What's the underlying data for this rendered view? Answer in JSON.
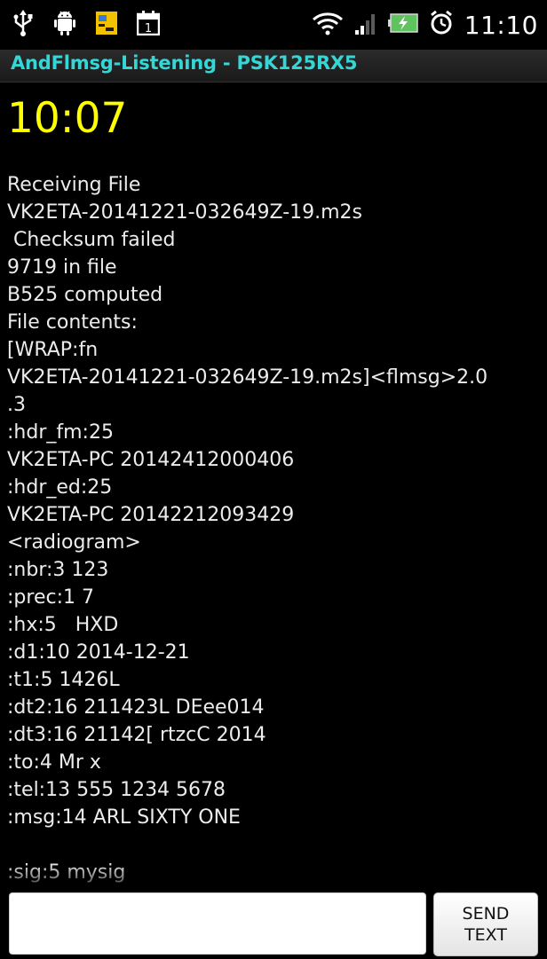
{
  "status_bar": {
    "time": "11:10",
    "left_icons": [
      "usb-icon",
      "android-debug-icon",
      "notification-app-icon",
      "calendar-icon"
    ],
    "right_icons": [
      "wifi-icon",
      "signal-icon",
      "battery-charging-icon",
      "alarm-icon"
    ],
    "calendar_day": "1"
  },
  "title_bar": {
    "title": "AndFlmsg-Listening - PSK125RX5",
    "color": "#35d6d6"
  },
  "clock": {
    "value": "10:07",
    "color": "#ffff00"
  },
  "log": {
    "lines": [
      "Receiving File",
      "VK2ETA-20141221-032649Z-19.m2s",
      " Checksum failed",
      "9719 in file",
      "B525 computed",
      "File contents:",
      "[WRAP:fn",
      "VK2ETA-20141221-032649Z-19.m2s]<flmsg>2.0",
      ".3",
      ":hdr_fm:25",
      "VK2ETA-PC 20142412000406",
      ":hdr_ed:25",
      "VK2ETA-PC 20142212093429",
      "<radiogram>",
      ":nbr:3 123",
      ":prec:1 7",
      ":hx:5   HXD",
      ":d1:10 2014-12-21",
      ":t1:5 1426L",
      ":dt2:16 211423L DEee014",
      ":dt3:16 21142[ rtzcC 2014",
      ":to:4 Mr x",
      ":tel:13 555 1234 5678",
      ":msg:14 ARL SIXTY ONE",
      "",
      ":sig:5 mysig"
    ]
  },
  "input": {
    "value": "",
    "placeholder": ""
  },
  "send_button": {
    "line1": "SEND",
    "line2": "TEXT"
  }
}
